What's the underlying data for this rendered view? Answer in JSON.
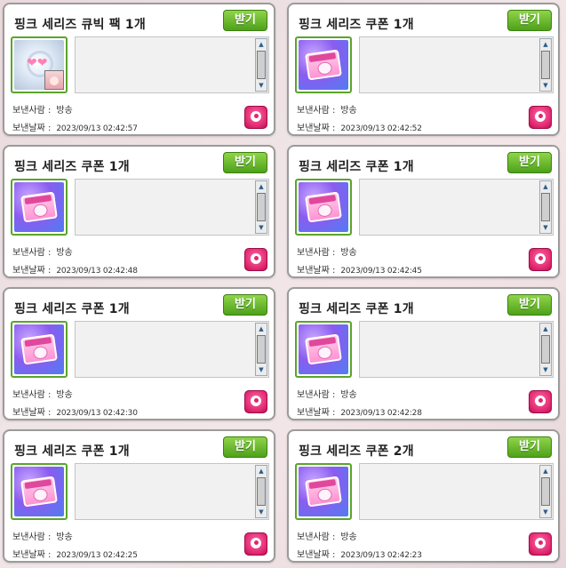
{
  "items": [
    {
      "title": "핑크 세리즈 큐빅 팩 1개",
      "accept_label": "받기",
      "icon": "cubic-pack-icon",
      "sender_label": "보낸사람 :",
      "sender": "방송",
      "date_label": "보낸날짜 :",
      "date": "2023/09/13 02:42:57"
    },
    {
      "title": "핑크 세리즈 쿠폰 1개",
      "accept_label": "받기",
      "icon": "coupon-icon",
      "sender_label": "보낸사람 :",
      "sender": "방송",
      "date_label": "보낸날짜 :",
      "date": "2023/09/13 02:42:52"
    },
    {
      "title": "핑크 세리즈 쿠폰 1개",
      "accept_label": "받기",
      "icon": "coupon-icon",
      "sender_label": "보낸사람 :",
      "sender": "방송",
      "date_label": "보낸날짜 :",
      "date": "2023/09/13 02:42:48"
    },
    {
      "title": "핑크 세리즈 쿠폰 1개",
      "accept_label": "받기",
      "icon": "coupon-icon",
      "sender_label": "보낸사람 :",
      "sender": "방송",
      "date_label": "보낸날짜 :",
      "date": "2023/09/13 02:42:45"
    },
    {
      "title": "핑크 세리즈 쿠폰 1개",
      "accept_label": "받기",
      "icon": "coupon-icon",
      "sender_label": "보낸사람 :",
      "sender": "방송",
      "date_label": "보낸날짜 :",
      "date": "2023/09/13 02:42:30"
    },
    {
      "title": "핑크 세리즈 쿠폰 1개",
      "accept_label": "받기",
      "icon": "coupon-icon",
      "sender_label": "보낸사람 :",
      "sender": "방송",
      "date_label": "보낸날짜 :",
      "date": "2023/09/13 02:42:28"
    },
    {
      "title": "핑크 세리즈 쿠폰 1개",
      "accept_label": "받기",
      "icon": "coupon-icon",
      "sender_label": "보낸사람 :",
      "sender": "방송",
      "date_label": "보낸날짜 :",
      "date": "2023/09/13 02:42:25"
    },
    {
      "title": "핑크 세리즈 쿠폰 2개",
      "accept_label": "받기",
      "icon": "coupon-icon",
      "sender_label": "보낸사람 :",
      "sender": "방송",
      "date_label": "보낸날짜 :",
      "date": "2023/09/13 02:42:23"
    }
  ],
  "colors": {
    "accept": "#5db325",
    "delete": "#e0266f",
    "icon_frame": "#5aa52a"
  }
}
